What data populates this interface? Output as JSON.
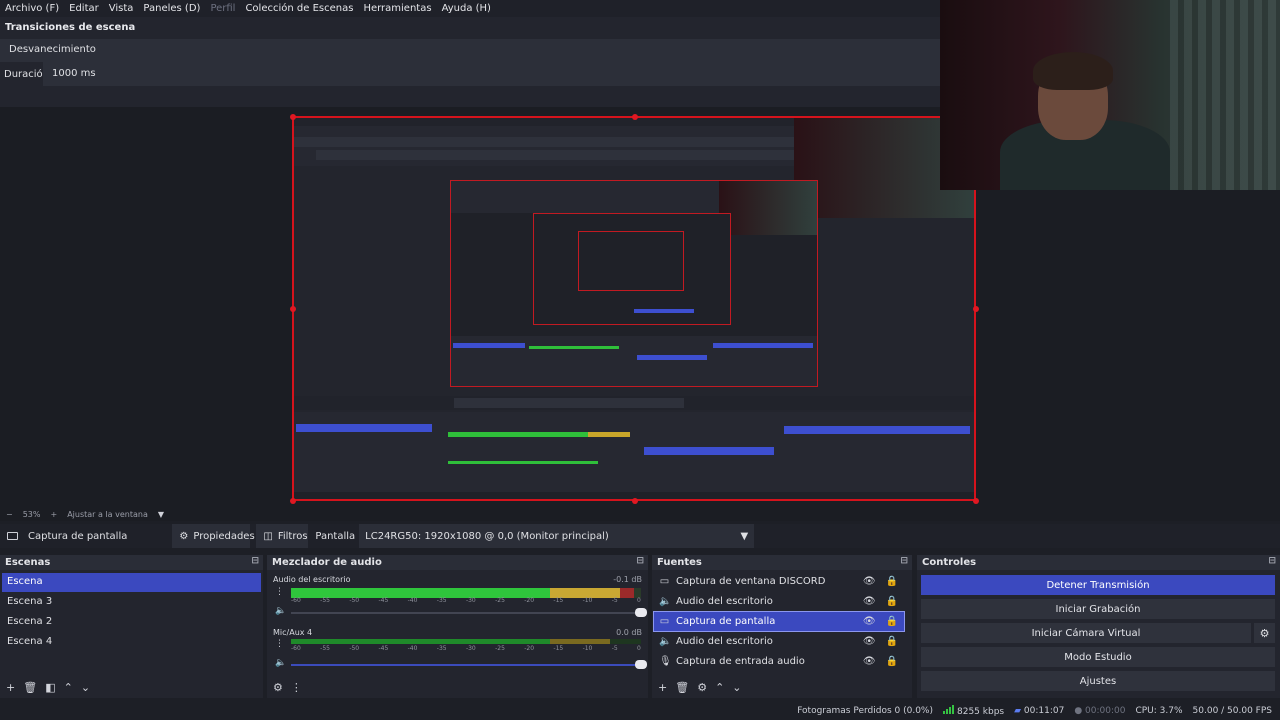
{
  "menu": [
    {
      "label": "Archivo (F)",
      "enabled": true
    },
    {
      "label": "Editar",
      "enabled": true
    },
    {
      "label": "Vista",
      "enabled": true
    },
    {
      "label": "Paneles (D)",
      "enabled": true
    },
    {
      "label": "Perfil",
      "enabled": false
    },
    {
      "label": "Colección de Escenas",
      "enabled": true
    },
    {
      "label": "Herramientas",
      "enabled": true
    },
    {
      "label": "Ayuda (H)",
      "enabled": true
    }
  ],
  "transitions": {
    "title": "Transiciones de escena",
    "selected": "Desvanecimiento",
    "duration_label": "Duración",
    "duration_value": "1000 ms"
  },
  "zoom": {
    "minus": "−",
    "value": "53%",
    "plus": "+",
    "fit_label": "Ajustar a la ventana",
    "dropdown": "▼"
  },
  "context": {
    "source_icon": "monitor-icon",
    "source_name": "Captura de pantalla",
    "properties_label": "Propiedades",
    "filters_label": "Filtros",
    "display_label": "Pantalla",
    "display_value": "LC24RG50: 1920x1080 @ 0,0 (Monitor principal)"
  },
  "scenes": {
    "title": "Escenas",
    "items": [
      "Escena",
      "Escena 3",
      "Escena 2",
      "Escena 4"
    ],
    "active_index": 0
  },
  "mixer": {
    "title": "Mezclador de audio",
    "channels": [
      {
        "name": "Audio del escritorio",
        "db": "-0.1 dB",
        "level": 0.98
      },
      {
        "name": "Mic/Aux 4",
        "db": "0.0 dB",
        "level": 0.91
      }
    ],
    "scale": [
      "-60",
      "-55",
      "-50",
      "-45",
      "-40",
      "-35",
      "-30",
      "-25",
      "-20",
      "-15",
      "-10",
      "-5",
      "0"
    ]
  },
  "sources": {
    "title": "Fuentes",
    "items": [
      {
        "name": "Captura de ventana DISCORD",
        "icon": "window-icon",
        "active": false
      },
      {
        "name": "Audio del escritorio",
        "icon": "speaker-icon",
        "active": false
      },
      {
        "name": "Captura de pantalla",
        "icon": "monitor-icon",
        "active": true
      },
      {
        "name": "Audio del escritorio",
        "icon": "speaker-icon",
        "active": false
      },
      {
        "name": "Captura de entrada audio",
        "icon": "microphone-icon",
        "active": false
      }
    ]
  },
  "controls": {
    "title": "Controles",
    "stop_stream": "Detener Transmisión",
    "start_recording": "Iniciar Grabación",
    "start_virtual_cam": "Iniciar Cámara Virtual",
    "studio_mode": "Modo Estudio",
    "settings": "Ajustes"
  },
  "status": {
    "dropped_frames": "Fotogramas Perdidos 0 (0.0%)",
    "bitrate": "8255 kbps",
    "stream_time": "00:11:07",
    "record_time": "00:00:00",
    "cpu": "CPU: 3.7%",
    "fps": "50.00 / 50.00 FPS"
  },
  "colors": {
    "accent": "#3b49bf",
    "preview_border": "#d5131c",
    "meter_green": "#2fc63c",
    "meter_yellow": "#c9a833"
  }
}
